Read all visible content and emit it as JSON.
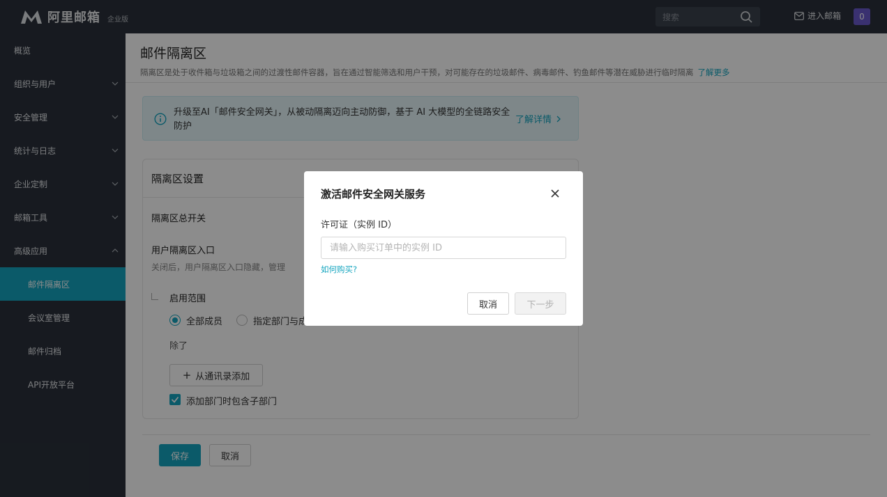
{
  "topbar": {
    "logo_text": "阿里邮箱",
    "logo_edition": "企业版",
    "search_placeholder": "搜索",
    "enter_mail_label": "进入邮箱",
    "notification_count": "0",
    "icons": [
      "logo-m-icon",
      "search-icon",
      "mail-icon"
    ]
  },
  "sidebar": {
    "items": [
      {
        "label": "概览",
        "expandable": false
      },
      {
        "label": "组织与用户",
        "expandable": true,
        "expanded": false
      },
      {
        "label": "安全管理",
        "expandable": true,
        "expanded": false
      },
      {
        "label": "统计与日志",
        "expandable": true,
        "expanded": false
      },
      {
        "label": "企业定制",
        "expandable": true,
        "expanded": false
      },
      {
        "label": "邮箱工具",
        "expandable": true,
        "expanded": false
      },
      {
        "label": "高级应用",
        "expandable": true,
        "expanded": true
      },
      {
        "label": "邮件隔离区",
        "sub": true,
        "active": true
      },
      {
        "label": "会议室管理",
        "sub": true
      },
      {
        "label": "邮件归档",
        "sub": true
      },
      {
        "label": "API开放平台",
        "sub": true
      }
    ]
  },
  "main": {
    "title": "邮件隔离区",
    "description": "隔离区是处于收件箱与垃圾箱之间的过渡性邮件容器，旨在通过智能筛选和用户干预，对可能存在的垃圾邮件、病毒邮件、钓鱼邮件等潜在威胁进行临时隔离",
    "learn_more": "了解更多",
    "banner": {
      "text": "升级至AI「邮件安全网关」，从被动隔离迈向主动防御，基于 AI 大模型的全链路安全防护",
      "link": "了解详情"
    },
    "settings": {
      "title": "隔离区设置",
      "master_switch_label": "隔离区总开关",
      "user_entry_label": "用户隔离区入口",
      "user_entry_desc": "关闭后，用户隔离区入口隐藏，管理",
      "scope_label": "启用范围",
      "scope_options": [
        "全部成员",
        "指定部门与成"
      ],
      "scope_selected": "全部成员",
      "except_label": "除了",
      "add_from_contacts": "从通讯录添加",
      "include_subdepts_label": "添加部门时包含子部门",
      "include_subdepts_checked": true
    },
    "save_label": "保存",
    "cancel_label": "取消"
  },
  "modal": {
    "title": "激活邮件安全网关服务",
    "field_label": "许可证（实例 ID）",
    "input_value": "",
    "input_placeholder": "请输入购买订单中的实例 ID",
    "how_to_buy": "如何购买?",
    "cancel_label": "取消",
    "next_label": "下一步"
  },
  "colors": {
    "accent": "#14a5bf",
    "sidebar_bg": "#2a313b",
    "badge_bg": "#6a5acd",
    "banner_bg": "#e6f6fa"
  }
}
